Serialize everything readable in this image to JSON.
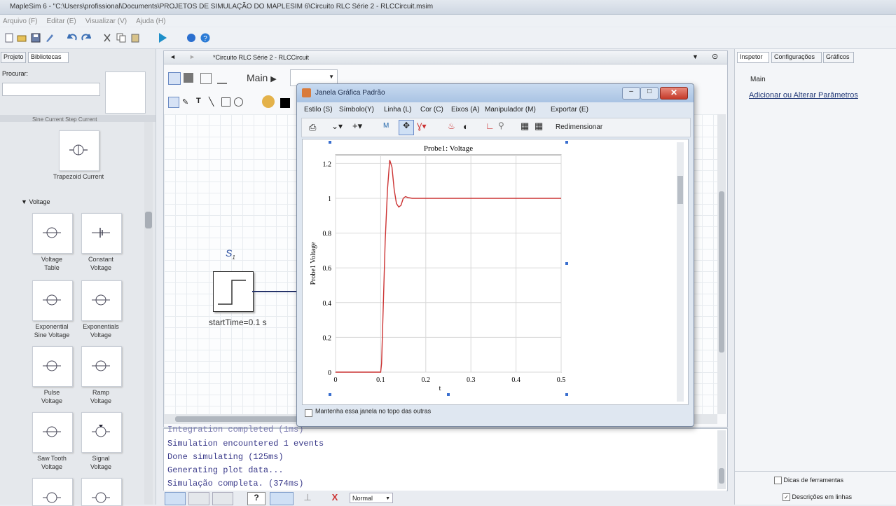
{
  "window": {
    "title": "MapleSim 6 - \"C:\\Users\\profissional\\Documents\\PROJETOS DE SIMULAÇÃO DO MAPLESIM 6\\Circuito RLC Série 2 - RLCCircuit.msim"
  },
  "menu": [
    "Arquivo (F)",
    "Editar (E)",
    "Visualizar (V)",
    "Ajuda (H)"
  ],
  "left_panel": {
    "tabs": [
      "Projeto",
      "Bibliotecas"
    ],
    "search_label": "Procurar:",
    "search_value": "",
    "partial_labels": "Sine Current   Step Current",
    "items_top": [
      {
        "label": "Trapezoid Current"
      }
    ],
    "section": "Voltage",
    "items": [
      {
        "label1": "Voltage",
        "label2": "Table"
      },
      {
        "label1": "Constant",
        "label2": "Voltage"
      },
      {
        "label1": "Exponential",
        "label2": "Sine Voltage"
      },
      {
        "label1": "Exponentials",
        "label2": "Voltage"
      },
      {
        "label1": "Pulse",
        "label2": "Voltage"
      },
      {
        "label1": "Ramp",
        "label2": "Voltage"
      },
      {
        "label1": "Saw Tooth",
        "label2": "Voltage"
      },
      {
        "label1": "Signal",
        "label2": "Voltage"
      }
    ]
  },
  "editor": {
    "tab_title": "*Circuito RLC Série 2 - RLCCircuit",
    "breadcrumb": "Main",
    "component_label": "S",
    "component_sub": "1",
    "component_param": "startTime=0.1 s"
  },
  "console": {
    "lines": [
      "Integration completed (1ms)",
      "Simulation encountered 1 events",
      "Done simulating (125ms)",
      "Generating plot data...",
      "Simulação completa. (374ms)"
    ]
  },
  "bottom": {
    "mode": "Normal"
  },
  "right_panel": {
    "tabs": [
      "Inspetor",
      "Configurações",
      "Gráficos"
    ],
    "main_label": "Main",
    "link": "Adicionar ou Alterar Parâmetros",
    "check1": "Dicas de ferramentas",
    "check2": "Descrições em linhas"
  },
  "plot_window": {
    "title": "Janela Gráfica Padrão",
    "menu": [
      "Estilo (S)",
      "Símbolo(Y)",
      "Linha (L)",
      "Cor (C)",
      "Eixos (A)",
      "Manipulador (M)",
      "Exportar (E)"
    ],
    "toolbar_resize": "Redimensionar",
    "footer_check": "Mantenha essa janela no topo das outras"
  },
  "chart_data": {
    "type": "line",
    "title": "Probe1: Voltage",
    "xlabel": "t",
    "ylabel": "Probe1 Voltage",
    "xlim": [
      0,
      0.5
    ],
    "ylim": [
      0,
      1.25
    ],
    "xticks": [
      0,
      0.1,
      0.2,
      0.3,
      0.4,
      0.5
    ],
    "xtick_labels": [
      "0",
      "0.1",
      "0.2",
      "0.3",
      "0.4",
      "0.5"
    ],
    "yticks": [
      0,
      0.2,
      0.4,
      0.6,
      0.8,
      1,
      1.2
    ],
    "ytick_labels": [
      "0",
      "0.2",
      "0.4",
      "0.6",
      "0.8",
      "1",
      "1.2"
    ],
    "grid": true,
    "color": "#cc3333",
    "series": [
      {
        "x": [
          0,
          0.1,
          0.102,
          0.11,
          0.115,
          0.12,
          0.125,
          0.13,
          0.135,
          0.14,
          0.145,
          0.15,
          0.155,
          0.16,
          0.17,
          0.18,
          0.2,
          0.25,
          0.3,
          0.4,
          0.5
        ],
        "y": [
          0,
          0,
          0.05,
          0.75,
          1.05,
          1.22,
          1.18,
          1.05,
          0.97,
          0.95,
          0.96,
          1.0,
          1.01,
          1.005,
          1.0,
          1.0,
          1.0,
          1.0,
          1.0,
          1.0,
          1.0
        ]
      }
    ]
  }
}
